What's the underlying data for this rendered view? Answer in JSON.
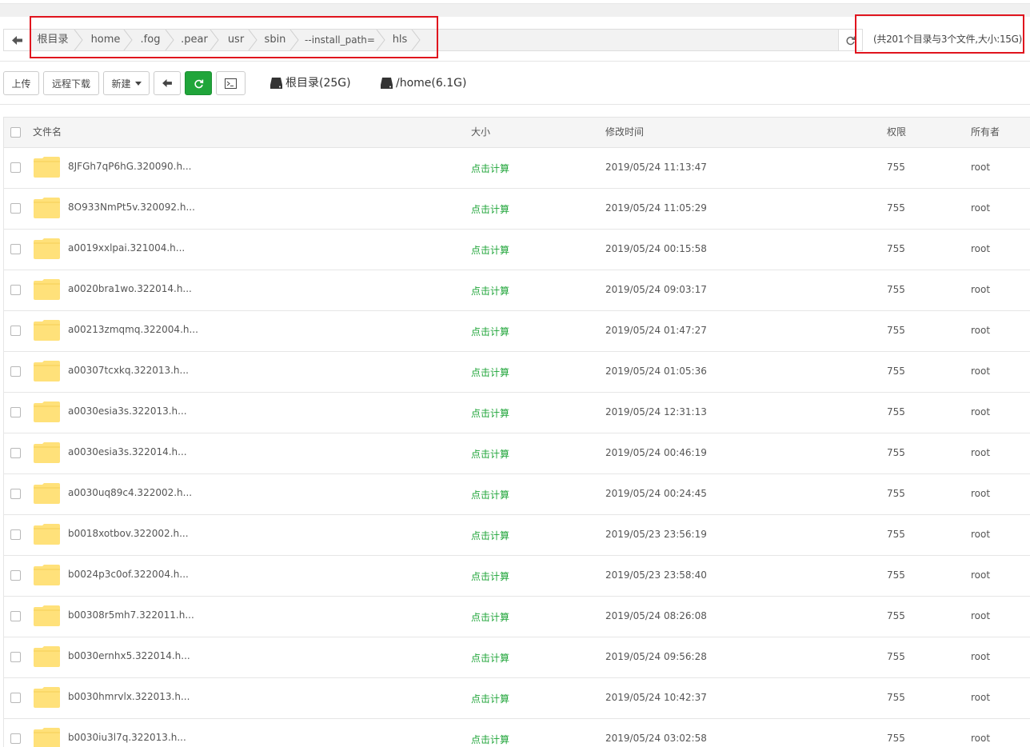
{
  "pathbar": {
    "crumbs": [
      "根目录",
      "home",
      ".fog",
      ".pear",
      "usr",
      "sbin",
      "--install_path=",
      "hls"
    ],
    "summary": "(共201个目录与3个文件,大小:15G)"
  },
  "toolbar": {
    "upload_label": "上传",
    "remote_download_label": "远程下载",
    "new_label": "新建",
    "disks": [
      "根目录(25G)",
      "/home(6.1G)"
    ]
  },
  "table": {
    "headers": {
      "name": "文件名",
      "size": "大小",
      "mtime": "修改时间",
      "perm": "权限",
      "owner": "所有者"
    },
    "rows": [
      {
        "name": "8JFGh7qP6hG.320090.h...",
        "size": "点击计算",
        "mtime": "2019/05/24 11:13:47",
        "perm": "755",
        "owner": "root"
      },
      {
        "name": "8O933NmPt5v.320092.h...",
        "size": "点击计算",
        "mtime": "2019/05/24 11:05:29",
        "perm": "755",
        "owner": "root"
      },
      {
        "name": "a0019xxlpai.321004.h...",
        "size": "点击计算",
        "mtime": "2019/05/24 00:15:58",
        "perm": "755",
        "owner": "root"
      },
      {
        "name": "a0020bra1wo.322014.h...",
        "size": "点击计算",
        "mtime": "2019/05/24 09:03:17",
        "perm": "755",
        "owner": "root"
      },
      {
        "name": "a00213zmqmq.322004.h...",
        "size": "点击计算",
        "mtime": "2019/05/24 01:47:27",
        "perm": "755",
        "owner": "root"
      },
      {
        "name": "a00307tcxkq.322013.h...",
        "size": "点击计算",
        "mtime": "2019/05/24 01:05:36",
        "perm": "755",
        "owner": "root"
      },
      {
        "name": "a0030esia3s.322013.h...",
        "size": "点击计算",
        "mtime": "2019/05/24 12:31:13",
        "perm": "755",
        "owner": "root"
      },
      {
        "name": "a0030esia3s.322014.h...",
        "size": "点击计算",
        "mtime": "2019/05/24 00:46:19",
        "perm": "755",
        "owner": "root"
      },
      {
        "name": "a0030uq89c4.322002.h...",
        "size": "点击计算",
        "mtime": "2019/05/24 00:24:45",
        "perm": "755",
        "owner": "root"
      },
      {
        "name": "b0018xotbov.322002.h...",
        "size": "点击计算",
        "mtime": "2019/05/23 23:56:19",
        "perm": "755",
        "owner": "root"
      },
      {
        "name": "b0024p3c0of.322004.h...",
        "size": "点击计算",
        "mtime": "2019/05/23 23:58:40",
        "perm": "755",
        "owner": "root"
      },
      {
        "name": "b00308r5mh7.322011.h...",
        "size": "点击计算",
        "mtime": "2019/05/24 08:26:08",
        "perm": "755",
        "owner": "root"
      },
      {
        "name": "b0030ernhx5.322014.h...",
        "size": "点击计算",
        "mtime": "2019/05/24 09:56:28",
        "perm": "755",
        "owner": "root"
      },
      {
        "name": "b0030hmrvlx.322013.h...",
        "size": "点击计算",
        "mtime": "2019/05/24 10:42:37",
        "perm": "755",
        "owner": "root"
      },
      {
        "name": "b0030iu3l7q.322013.h...",
        "size": "点击计算",
        "mtime": "2019/05/24 03:02:58",
        "perm": "755",
        "owner": "root"
      }
    ]
  },
  "colors": {
    "accent_green": "#20a53a",
    "highlight_red": "#e0141e",
    "folder_yellow": "#ffe17a"
  }
}
